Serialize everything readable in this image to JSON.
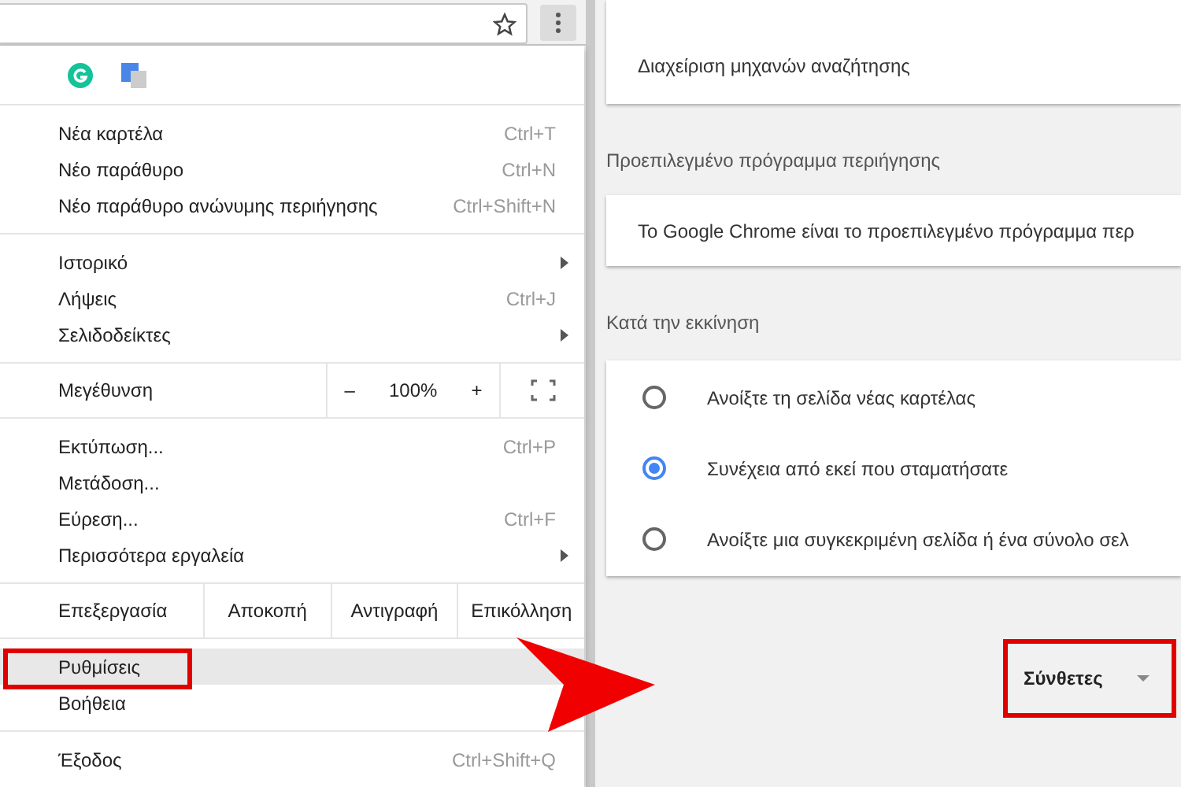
{
  "menu": {
    "sections": [
      {
        "kind": "items",
        "items": [
          {
            "label": "Νέα καρτέλα",
            "shortcut": "Ctrl+T",
            "submenu": false,
            "selected": false,
            "outlined": false
          },
          {
            "label": "Νέο παράθυρο",
            "shortcut": "Ctrl+N",
            "submenu": false,
            "selected": false,
            "outlined": false
          },
          {
            "label": "Νέο παράθυρο ανώνυμης περιήγησης",
            "shortcut": "Ctrl+Shift+N",
            "submenu": false,
            "selected": false,
            "outlined": false
          }
        ]
      },
      {
        "kind": "items",
        "items": [
          {
            "label": "Ιστορικό",
            "submenu": true,
            "selected": false,
            "outlined": false
          },
          {
            "label": "Λήψεις",
            "shortcut": "Ctrl+J",
            "submenu": false,
            "selected": false,
            "outlined": false
          },
          {
            "label": "Σελιδοδείκτες",
            "submenu": true,
            "selected": false,
            "outlined": false
          }
        ]
      },
      {
        "kind": "zoom",
        "label": "Μεγέθυνση",
        "minus": "–",
        "value": "100%",
        "plus": "+"
      },
      {
        "kind": "items",
        "items": [
          {
            "label": "Εκτύπωση...",
            "shortcut": "Ctrl+P",
            "submenu": false,
            "selected": false,
            "outlined": false
          },
          {
            "label": "Μετάδοση...",
            "submenu": false,
            "selected": false,
            "outlined": false
          },
          {
            "label": "Εύρεση...",
            "shortcut": "Ctrl+F",
            "submenu": false,
            "selected": false,
            "outlined": false
          },
          {
            "label": "Περισσότερα εργαλεία",
            "submenu": true,
            "selected": false,
            "outlined": false
          }
        ]
      },
      {
        "kind": "edit",
        "label": "Επεξεργασία",
        "buttons": [
          "Αποκοπή",
          "Αντιγραφή",
          "Επικόλληση"
        ]
      },
      {
        "kind": "items",
        "items": [
          {
            "label": "Ρυθμίσεις",
            "submenu": false,
            "selected": true,
            "outlined": true
          },
          {
            "label": "Βοήθεια",
            "submenu": false,
            "selected": false,
            "outlined": false
          }
        ]
      },
      {
        "kind": "items",
        "items": [
          {
            "label": "Έξοδος",
            "shortcut": "Ctrl+Shift+Q",
            "submenu": false,
            "selected": false,
            "outlined": false
          }
        ]
      }
    ]
  },
  "settings": {
    "search_card": {
      "item": "Διαχείριση μηχανών αναζήτησης"
    },
    "default_browser": {
      "heading": "Προεπιλεγμένο πρόγραμμα περιήγησης",
      "text": "Το Google Chrome είναι το προεπιλεγμένο πρόγραμμα περ"
    },
    "startup": {
      "heading": "Κατά την εκκίνηση",
      "options": [
        {
          "label": "Ανοίξτε τη σελίδα νέας καρτέλας",
          "selected": false
        },
        {
          "label": "Συνέχεια από εκεί που σταματήσατε",
          "selected": true
        },
        {
          "label": "Ανοίξτε μια συγκεκριμένη σελίδα ή ένα σύνολο σελ",
          "selected": false
        }
      ]
    },
    "advanced": {
      "label": "Σύνθετες",
      "outlined": true
    }
  }
}
